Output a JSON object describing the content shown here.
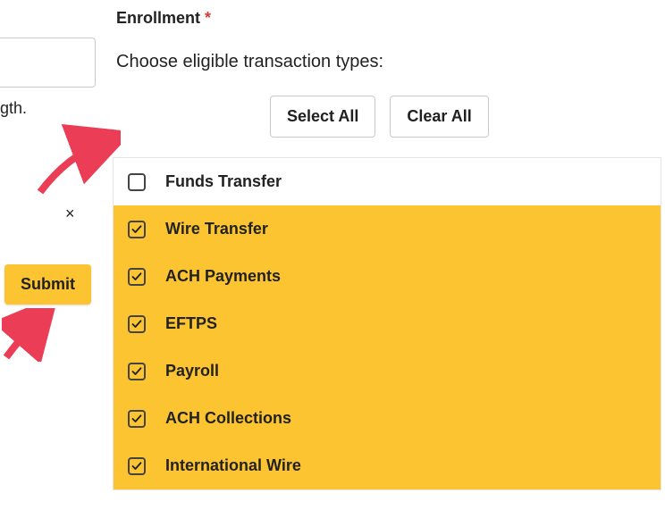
{
  "left": {
    "trailing_text": "gth.",
    "close_glyph": "×",
    "submit_label": "Submit"
  },
  "enrollment": {
    "label": "Enrollment",
    "required_mark": "*",
    "help_text": "Choose eligible transaction types:",
    "select_all_label": "Select All",
    "clear_all_label": "Clear All",
    "items": [
      {
        "label": "Funds Transfer",
        "checked": false
      },
      {
        "label": "Wire Transfer",
        "checked": true
      },
      {
        "label": "ACH Payments",
        "checked": true
      },
      {
        "label": "EFTPS",
        "checked": true
      },
      {
        "label": "Payroll",
        "checked": true
      },
      {
        "label": "ACH Collections",
        "checked": true
      },
      {
        "label": "International Wire",
        "checked": true
      }
    ]
  }
}
